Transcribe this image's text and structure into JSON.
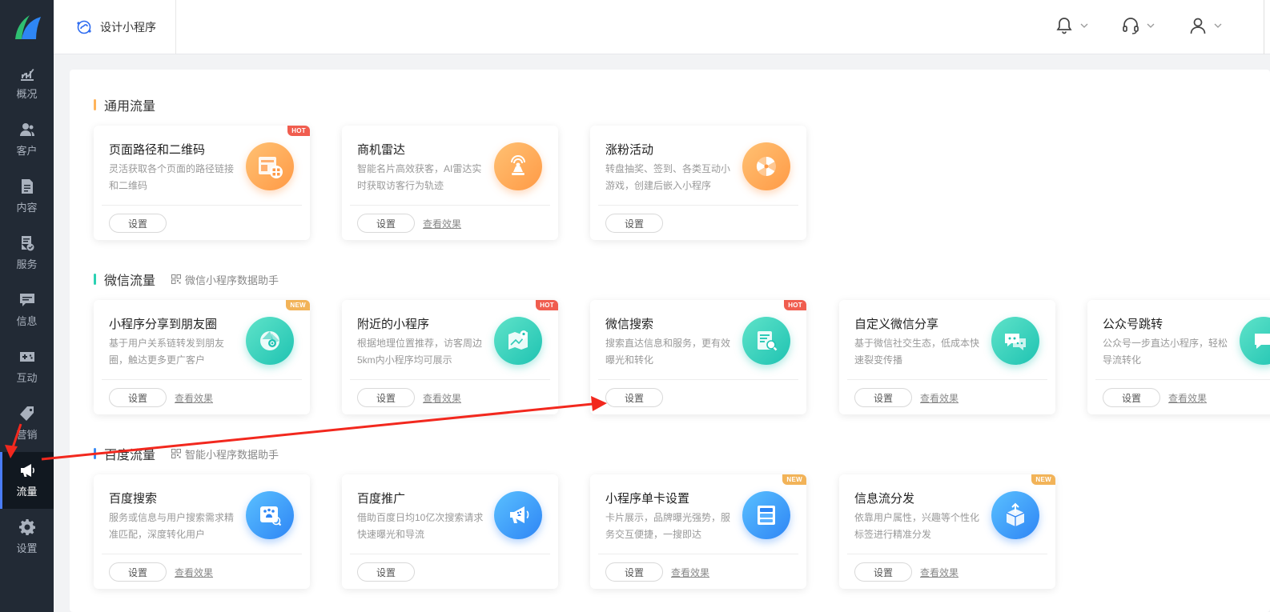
{
  "topbar": {
    "page_title": "设计小程序"
  },
  "sidebar": {
    "items": [
      {
        "label": "概况"
      },
      {
        "label": "客户"
      },
      {
        "label": "内容"
      },
      {
        "label": "服务"
      },
      {
        "label": "信息"
      },
      {
        "label": "互动"
      },
      {
        "label": "营销"
      },
      {
        "label": "流量"
      },
      {
        "label": "设置"
      }
    ]
  },
  "sections": {
    "general": {
      "title": "通用流量",
      "cards": [
        {
          "title": "页面路径和二维码",
          "desc": "灵活获取各个页面的路径链接和二维码",
          "btn": "设置",
          "badge": "HOT"
        },
        {
          "title": "商机雷达",
          "desc": "智能名片高效获客，AI雷达实时获取访客行为轨迹",
          "btn": "设置",
          "link": "查看效果"
        },
        {
          "title": "涨粉活动",
          "desc": "转盘抽奖、签到、各类互动小游戏，创建后嵌入小程序",
          "btn": "设置"
        }
      ]
    },
    "wechat": {
      "title": "微信流量",
      "helper": "微信小程序数据助手",
      "cards": [
        {
          "title": "小程序分享到朋友圈",
          "desc": "基于用户关系链转发到朋友圈，触达更多更广客户",
          "btn": "设置",
          "link": "查看效果",
          "badge": "NEW"
        },
        {
          "title": "附近的小程序",
          "desc": "根据地理位置推荐，访客周边5km内小程序均可展示",
          "btn": "设置",
          "link": "查看效果",
          "badge": "HOT"
        },
        {
          "title": "微信搜索",
          "desc": "搜索直达信息和服务，更有效曝光和转化",
          "btn": "设置",
          "badge": "HOT"
        },
        {
          "title": "自定义微信分享",
          "desc": "基于微信社交生态，低成本快速裂变传播",
          "btn": "设置",
          "link": "查看效果"
        },
        {
          "title": "公众号跳转",
          "desc": "公众号一步直达小程序，轻松导流转化",
          "btn": "设置",
          "link": "查看效果"
        }
      ]
    },
    "baidu": {
      "title": "百度流量",
      "helper": "智能小程序数据助手",
      "cards": [
        {
          "title": "百度搜索",
          "desc": "服务或信息与用户搜索需求精准匹配，深度转化用户",
          "btn": "设置",
          "link": "查看效果"
        },
        {
          "title": "百度推广",
          "desc": "借助百度日均10亿次搜索请求快速曝光和导流",
          "btn": "设置"
        },
        {
          "title": "小程序单卡设置",
          "desc": "卡片展示，品牌曝光强势，服务交互便捷，一搜即达",
          "btn": "设置",
          "link": "查看效果",
          "badge": "NEW"
        },
        {
          "title": "信息流分发",
          "desc": "依靠用户属性，兴趣等个性化标签进行精准分发",
          "btn": "设置",
          "link": "查看效果",
          "badge": "NEW"
        }
      ]
    }
  },
  "colors": {
    "accent_orange": "#ff9a46",
    "accent_teal": "#1fc3b2",
    "accent_blue": "#2e85f5",
    "annotation_red": "#f2281e",
    "sidebar_bg": "#222a35"
  }
}
